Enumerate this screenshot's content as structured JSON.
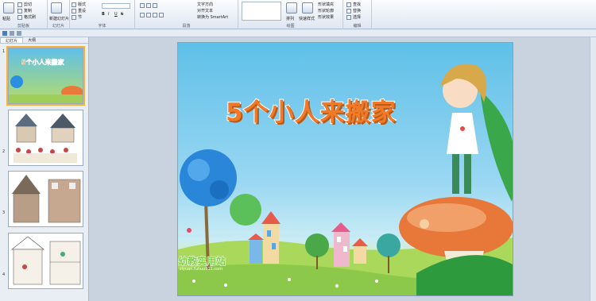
{
  "ribbon": {
    "clipboard": {
      "paste": "粘贴",
      "cut": "剪切",
      "copy": "复制",
      "format_painter": "格式刷",
      "caption": "剪贴板"
    },
    "slides": {
      "new_slide": "新建幻灯片",
      "layout": "版式",
      "reset": "重设",
      "section": "节",
      "caption": "幻灯片"
    },
    "font": {
      "caption": "字体",
      "bold": "B",
      "italic": "I",
      "underline": "U",
      "strike": "S"
    },
    "paragraph": {
      "text_direction": "文字方向",
      "align_text": "对齐文本",
      "smartart": "转换为 SmartArt",
      "caption": "段落"
    },
    "drawing": {
      "arrange": "排列",
      "quick_styles": "快速样式",
      "shape_fill": "形状填充",
      "shape_outline": "形状轮廓",
      "shape_effects": "形状效果",
      "caption": "绘图"
    },
    "editing": {
      "find": "查找",
      "replace": "替换",
      "select": "选择",
      "caption": "编辑"
    }
  },
  "panel": {
    "tabs": [
      "幻灯片",
      "大纲"
    ],
    "slides": [
      {
        "num": "1",
        "label": "5个小人来搬家"
      },
      {
        "num": "2"
      },
      {
        "num": "3"
      },
      {
        "num": "4"
      }
    ]
  },
  "slide": {
    "title": "5个小人来搬家",
    "watermark": "幼教实用站",
    "watermark_url": "ziyuan.fuhuo911.com"
  },
  "colors": {
    "title": "#f07a28",
    "sky": "#8fd3f0",
    "grass": "#b5dc6a",
    "selection": "#f3b33d"
  }
}
